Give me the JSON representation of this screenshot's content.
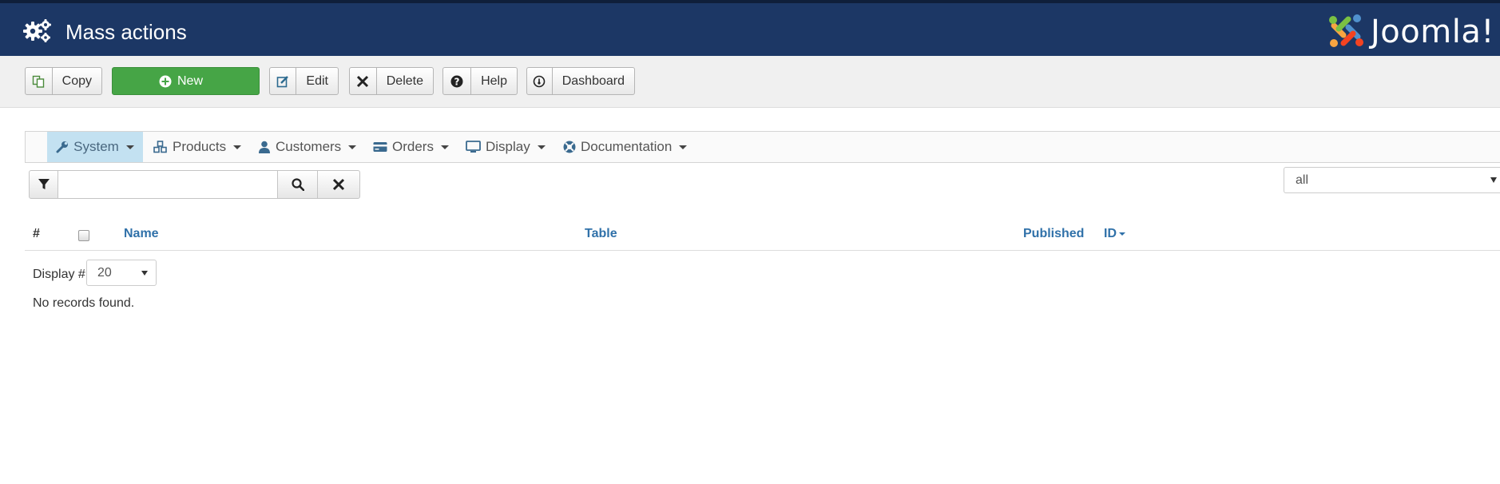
{
  "header": {
    "title": "Mass actions",
    "title_icon": "gears-icon",
    "logo_text": "Joomla!",
    "background": "#1c3765"
  },
  "toolbar": {
    "copy_label": "Copy",
    "new_label": "New",
    "edit_label": "Edit",
    "delete_label": "Delete",
    "help_label": "Help",
    "dashboard_label": "Dashboard",
    "new_color": "#46a546"
  },
  "nav": {
    "items": [
      {
        "label": "System",
        "icon": "wrench-icon",
        "active": true
      },
      {
        "label": "Products",
        "icon": "cubes-icon"
      },
      {
        "label": "Customers",
        "icon": "user-icon"
      },
      {
        "label": "Orders",
        "icon": "credit-card-icon"
      },
      {
        "label": "Display",
        "icon": "monitor-icon"
      },
      {
        "label": "Documentation",
        "icon": "lifebuoy-icon"
      }
    ],
    "active_color": "#c3e1f1"
  },
  "search": {
    "value": "",
    "placeholder": ""
  },
  "filter": {
    "selected": "all"
  },
  "table": {
    "columns": {
      "number": "#",
      "name": "Name",
      "table": "Table",
      "published": "Published",
      "id": "ID"
    },
    "link_color": "#3071a9"
  },
  "pagination": {
    "display_label": "Display #",
    "limit": "20"
  },
  "empty_message": "No records found."
}
